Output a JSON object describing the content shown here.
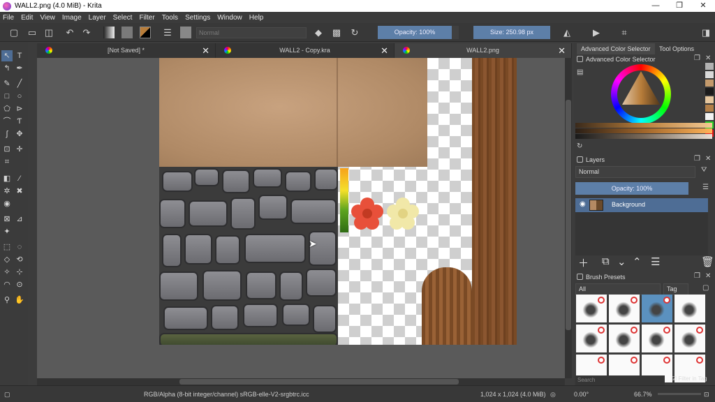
{
  "window": {
    "title": "WALL2.png (4.0 MiB) - Krita",
    "minimize": "—",
    "maximize": "❐",
    "close": "✕"
  },
  "menu": [
    "File",
    "Edit",
    "View",
    "Image",
    "Layer",
    "Select",
    "Filter",
    "Tools",
    "Settings",
    "Window",
    "Help"
  ],
  "toolbar": {
    "blend_mode": "Normal",
    "opacity": "Opacity: 100%",
    "size": "Size: 250.98 px"
  },
  "tabs": [
    {
      "label": "[Not Saved]  *",
      "close": "✕"
    },
    {
      "label": "WALL2 - Copy.kra",
      "close": "✕"
    },
    {
      "label": "WALL2.png",
      "close": "✕"
    }
  ],
  "docker": {
    "tab_color_selector": "Advanced Color Selector",
    "tab_tool_options": "Tool Options",
    "color_selector_title": "Advanced Color Selector",
    "layers_title": "Layers",
    "layer_blend_mode": "Normal",
    "layer_opacity": "Opacity:  100%",
    "layer_name": "Background",
    "brush_presets_title": "Brush Presets",
    "brush_filter": "All",
    "brush_tag": "Tag",
    "search_placeholder": "Search",
    "filter_in_tag": "Filter in Tag"
  },
  "status": {
    "color_info": "RGB/Alpha (8-bit integer/channel)  sRGB-elle-V2-srgbtrc.icc",
    "image_size": "1,024 x 1,024 (4.0 MiB)",
    "rotation": "0.00°",
    "zoom": "66.7%"
  },
  "colors": {
    "accent": "#4e6d95",
    "slider": "#5d7fa8",
    "fg_color": "#b87d3a"
  }
}
